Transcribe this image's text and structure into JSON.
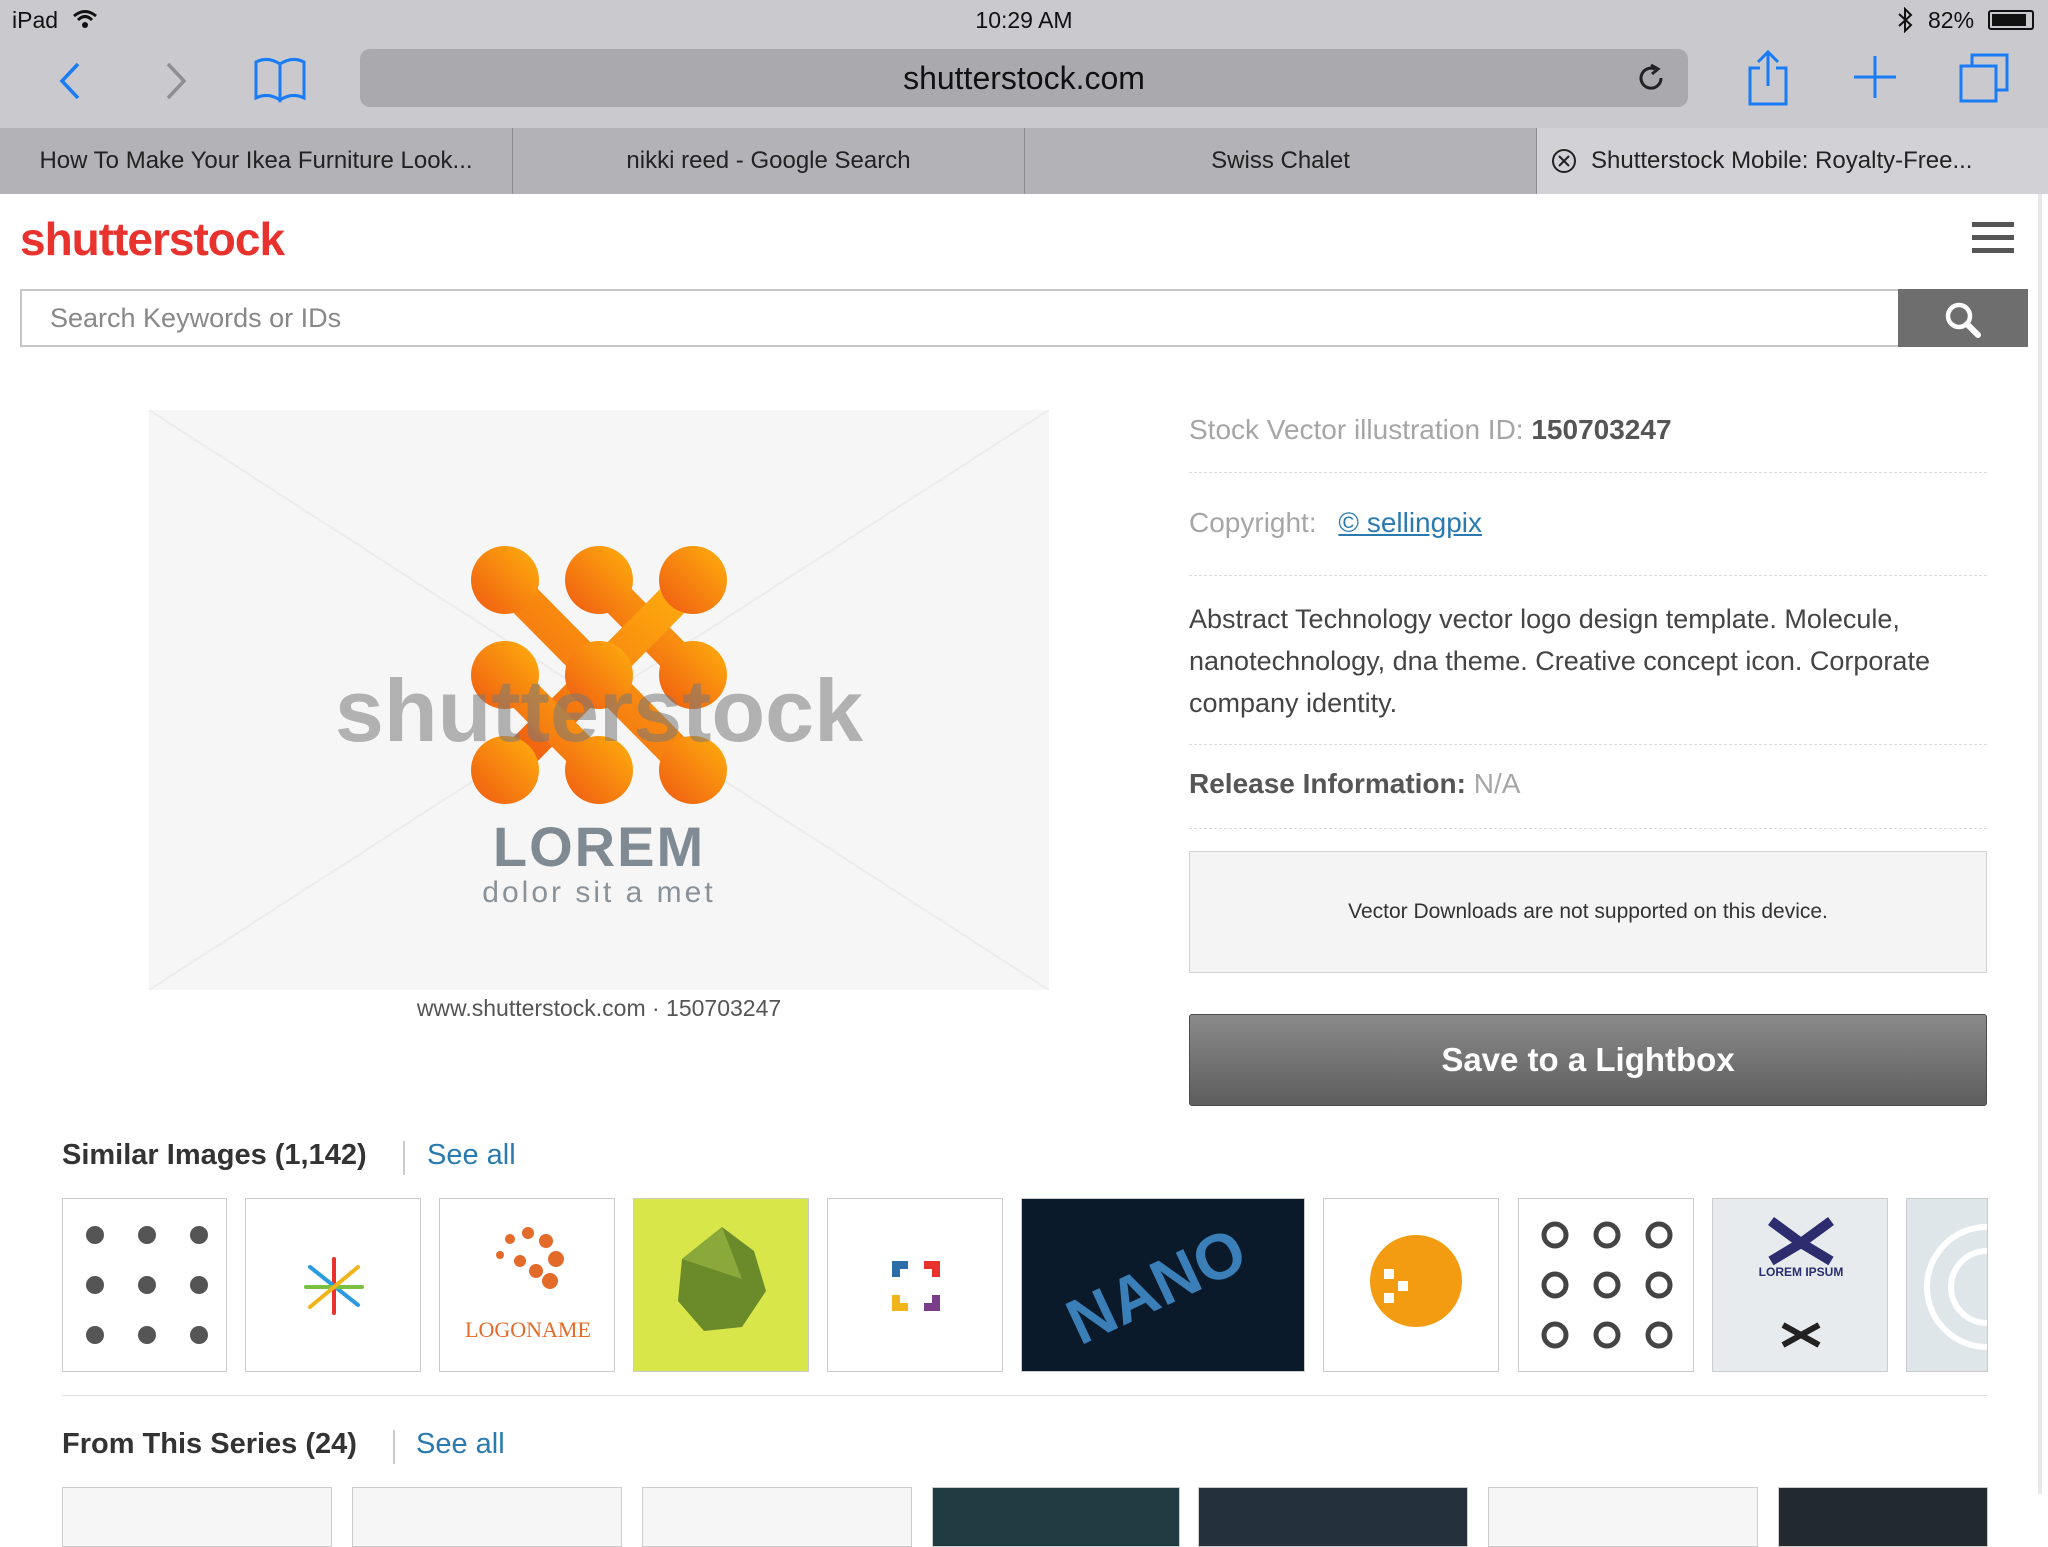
{
  "status": {
    "device": "iPad",
    "time": "10:29 AM",
    "battery": "82%"
  },
  "browser": {
    "url": "shutterstock.com"
  },
  "tabs": [
    {
      "label": "How To Make Your Ikea Furniture Look..."
    },
    {
      "label": "nikki reed - Google Search"
    },
    {
      "label": "Swiss Chalet"
    },
    {
      "label": "Shutterstock Mobile: Royalty-Free..."
    }
  ],
  "site": {
    "logo": "shutterstock",
    "search_placeholder": "Search Keywords or IDs"
  },
  "image": {
    "watermark": "shutterstock",
    "logo_title": "LOREM",
    "logo_sub": "dolor sit a met",
    "caption": "www.shutterstock.com · 150703247"
  },
  "details": {
    "id_label": "Stock Vector illustration ID:",
    "id_value": "150703247",
    "copyright_label": "Copyright:",
    "copyright_value": "© sellingpix",
    "description": "Abstract Technology vector logo design template. Molecule, nanotechnology, dna theme. Creative concept icon. Corporate company identity.",
    "release_label": "Release Information:",
    "release_value": "N/A",
    "notice": "Vector Downloads are not supported on this device.",
    "save_label": "Save to a Lightbox"
  },
  "similar": {
    "title": "Similar Images (1,142)",
    "see_all": "See all"
  },
  "series": {
    "title": "From This Series (24)",
    "see_all": "See all"
  },
  "thumb_text": {
    "logoname": "LOGONAME",
    "nano": "NANO",
    "lorem_ipsum": "LOREM IPSUM"
  },
  "colors": {
    "brand": "#e8322e",
    "link": "#2a7ab0",
    "ios_blue": "#1a7cf5"
  }
}
